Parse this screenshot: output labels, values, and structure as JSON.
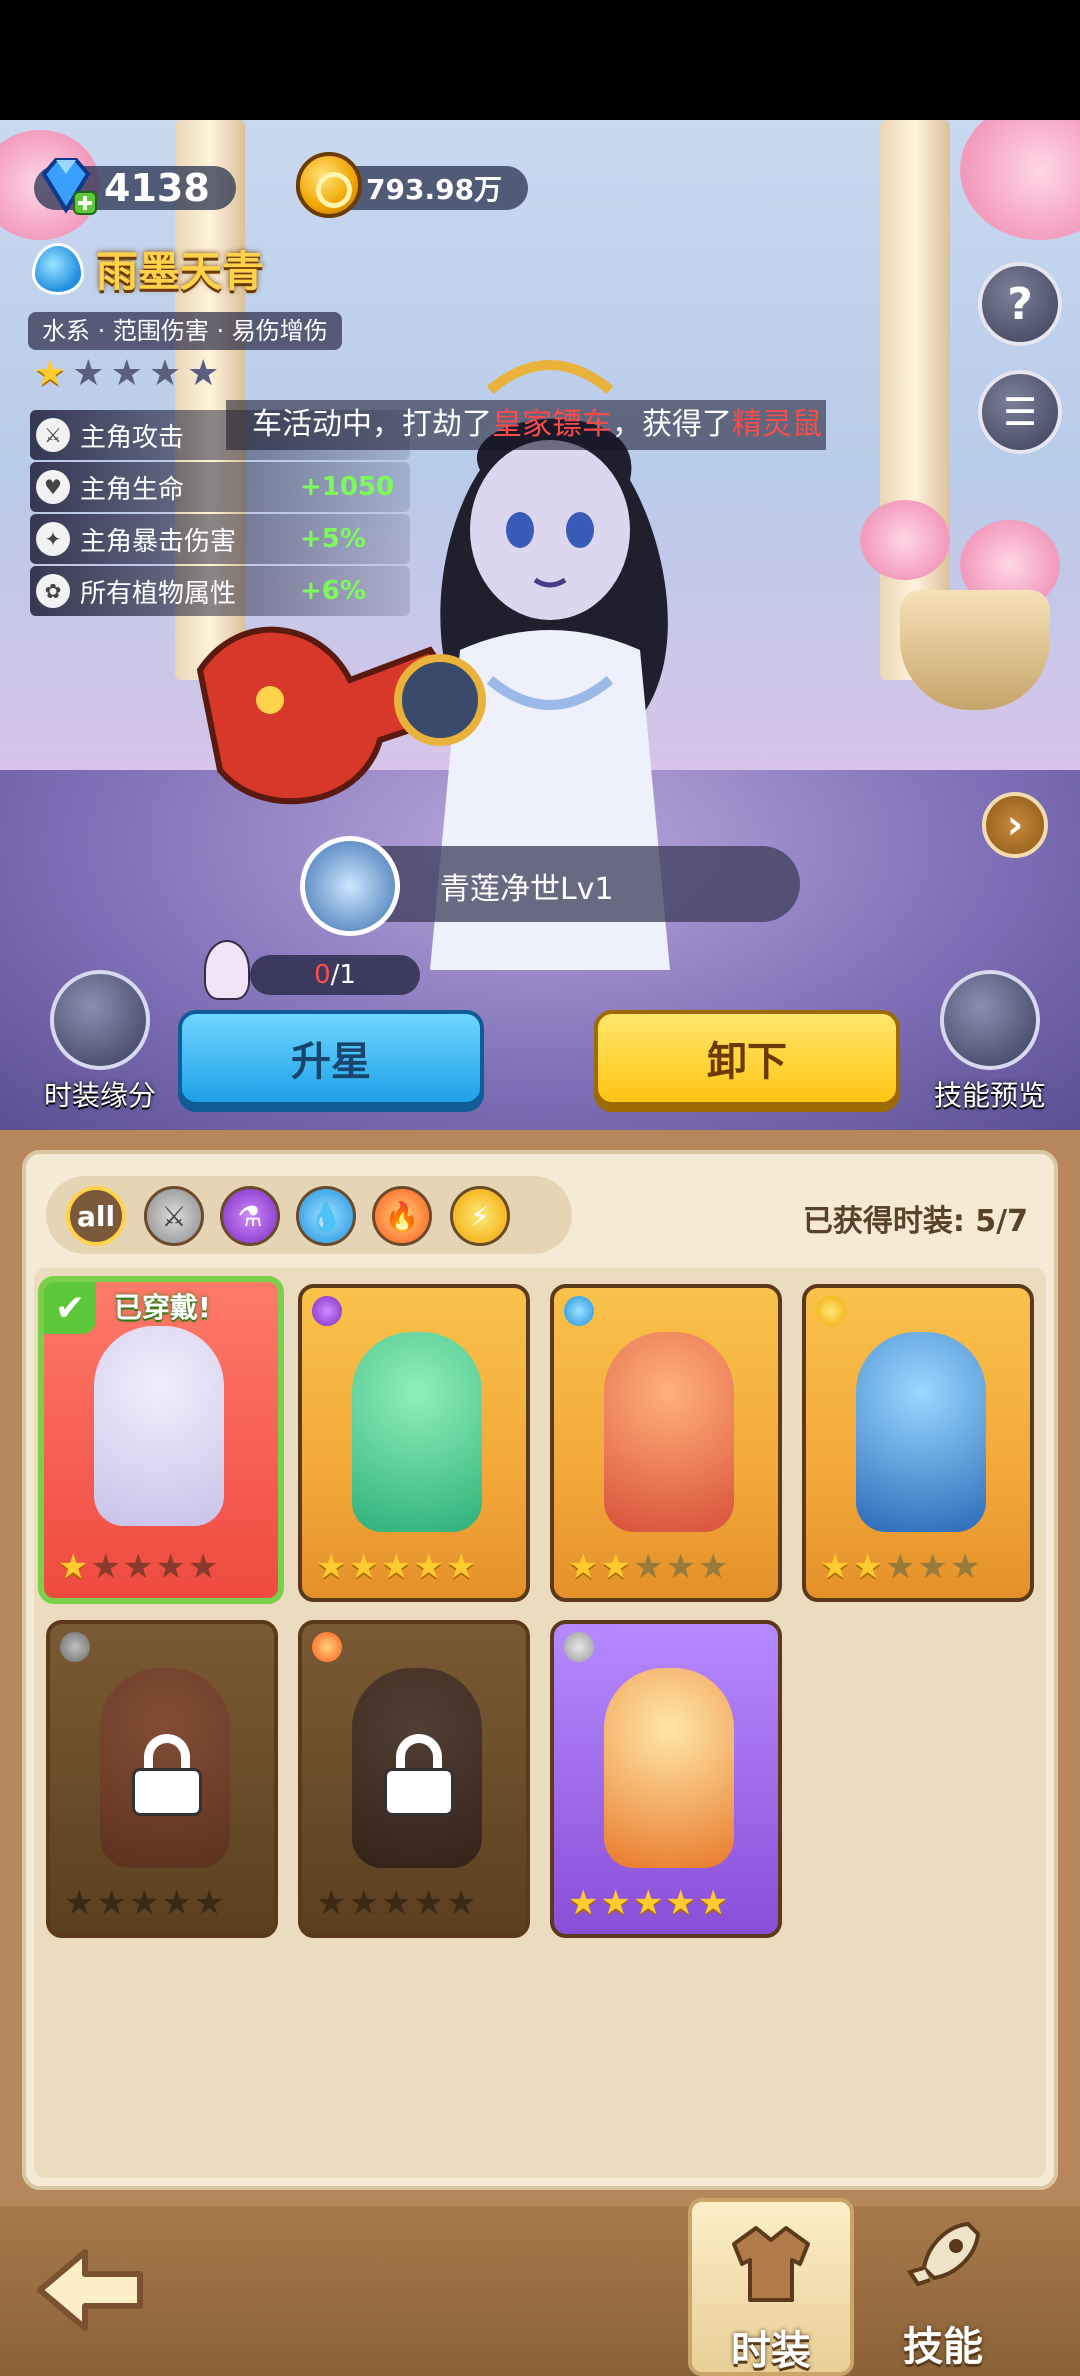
{
  "resources": {
    "gems": "4138",
    "coins": "793.98万"
  },
  "hero": {
    "name": "雨墨天青",
    "tags": "水系 · 范围伤害 · 易伤增伤",
    "stars_filled": 1,
    "stars_total": 5
  },
  "ticker": {
    "prefix": "车活动中，打劫了",
    "highlight1": "皇家镖车",
    "middle": "，获得了",
    "highlight2": "精灵鼠"
  },
  "attributes": [
    {
      "name": "主角攻击",
      "value": "",
      "icon": "sword-icon"
    },
    {
      "name": "主角生命",
      "value": "+1050",
      "icon": "heart-icon"
    },
    {
      "name": "主角暴击伤害",
      "value": "+5%",
      "icon": "crit-icon"
    },
    {
      "name": "所有植物属性",
      "value": "+6%",
      "icon": "plant-icon"
    }
  ],
  "skill_chip": {
    "label": "青莲净世Lv1"
  },
  "fragment_progress": {
    "current": "0",
    "total": "/1"
  },
  "side_buttons": {
    "left_label": "时装缘分",
    "right_label": "技能预览"
  },
  "actions": {
    "upgrade_star": "升星",
    "unequip": "卸下"
  },
  "filters": {
    "all_label": "all",
    "items": [
      "metal-element-icon",
      "poison-element-icon",
      "water-element-icon",
      "fire-element-icon",
      "thunder-element-icon"
    ]
  },
  "owned_text": "已获得时装: 5/7",
  "costumes": [
    {
      "state": "equipped",
      "badge_label": "已穿戴!",
      "stars": 1,
      "element": "water"
    },
    {
      "state": "owned",
      "stars": 5,
      "element": "poison"
    },
    {
      "state": "owned",
      "stars": 2,
      "element": "water"
    },
    {
      "state": "owned",
      "stars": 2,
      "element": "thunder"
    },
    {
      "state": "locked",
      "stars": 0,
      "element": "metal"
    },
    {
      "state": "locked",
      "stars": 0,
      "element": "fire"
    },
    {
      "state": "owned",
      "stars": 5,
      "element": "metal"
    }
  ],
  "bottom_nav": {
    "costume_tab": "时装",
    "skill_tab": "技能"
  },
  "colors": {
    "gold": "#ffcb2e",
    "accent_green": "#7dfa5a",
    "alert_red": "#ff4a4a",
    "panel_bg": "#f4ead6"
  }
}
